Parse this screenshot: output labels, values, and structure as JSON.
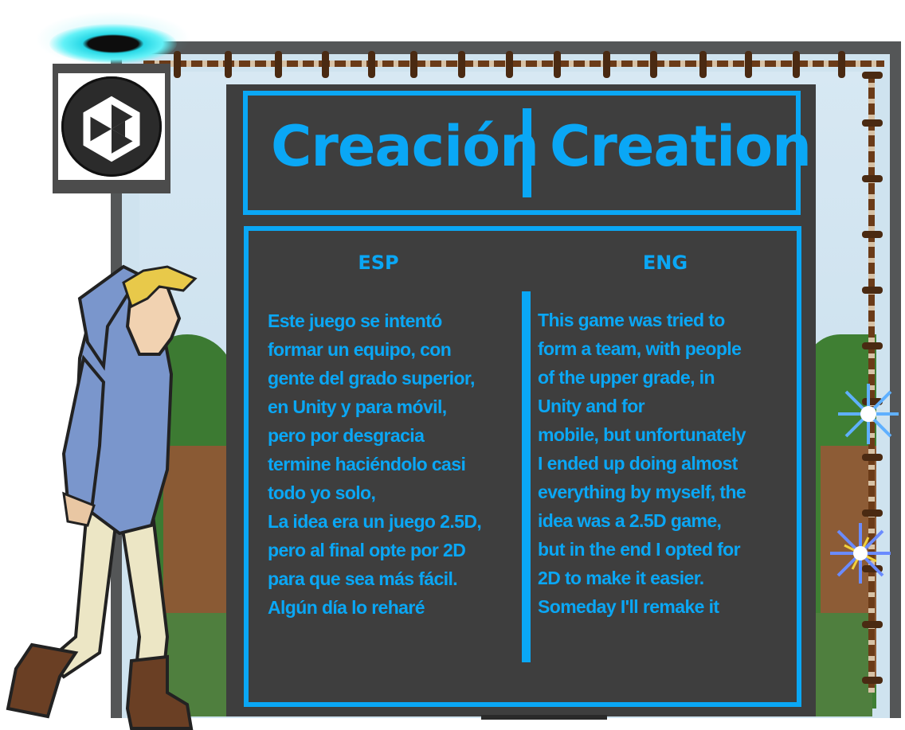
{
  "title": {
    "left": "Creación",
    "right": "Creation"
  },
  "columns": {
    "esp_header": "ESP",
    "eng_header": "ENG"
  },
  "esp_lines": [
    "Este juego se intentó",
    "formar un equipo, con",
    "gente del grado superior,",
    "en Unity y para móvil,",
    "pero por desgracia",
    "termine haciéndolo casi",
    "todo yo solo,",
    "La idea era un juego 2.5D,",
    "pero al final opte por 2D",
    "para que sea más fácil.",
    "Algún día lo reharé"
  ],
  "eng_lines": [
    "This game was tried to",
    "form a team, with people",
    "of the upper grade, in",
    "Unity and for",
    "mobile, but unfortunately",
    "I ended up doing almost",
    "everything by myself, the",
    "idea was a 2.5D game,",
    "but in the end I opted for",
    "2D to make it easier.",
    "Someday I'll remake it"
  ],
  "icons": {
    "logo": "unity-logo-icon",
    "portal": "portal-icon",
    "character": "boy-character-icon",
    "sparkle": "sparkle-icon"
  },
  "colors": {
    "accent": "#0aa7f5",
    "panel": "#3e3e3e",
    "frame": "#545657"
  }
}
